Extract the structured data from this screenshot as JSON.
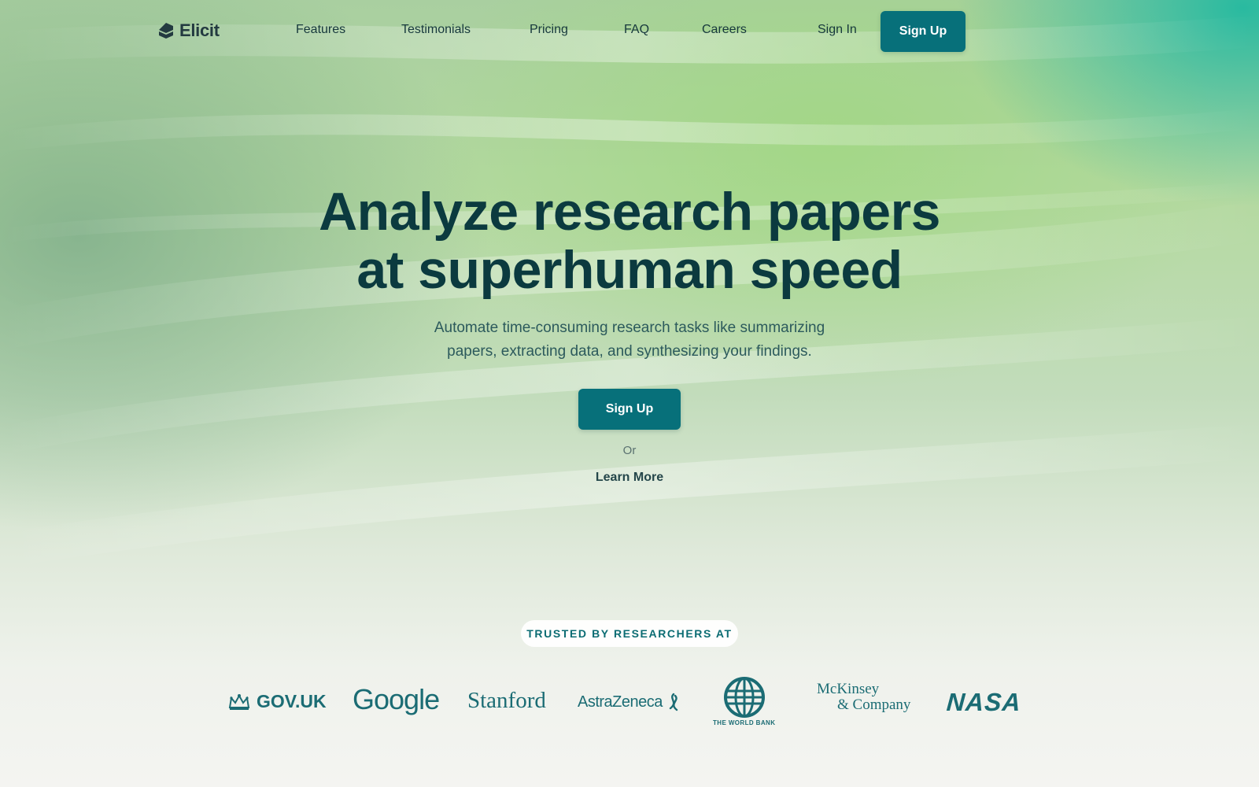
{
  "brand": {
    "name": "Elicit",
    "logo_icon": "elicit-logo-icon"
  },
  "nav": {
    "links": [
      {
        "label": "Features"
      },
      {
        "label": "Testimonials"
      },
      {
        "label": "Pricing"
      },
      {
        "label": "FAQ"
      },
      {
        "label": "Careers"
      }
    ],
    "sign_in": "Sign In",
    "sign_up": "Sign Up"
  },
  "hero": {
    "title_line1": "Analyze research papers",
    "title_line2": "at superhuman speed",
    "subtitle_line1": "Automate time-consuming research tasks like summarizing",
    "subtitle_line2": "papers, extracting data, and synthesizing your findings.",
    "cta": "Sign Up",
    "or": "Or",
    "learn_more": "Learn More"
  },
  "trusted": {
    "label": "TRUSTED BY RESEARCHERS AT",
    "logos": [
      {
        "name": "GOV.UK",
        "icon": "crown-icon"
      },
      {
        "name": "Google"
      },
      {
        "name": "Stanford"
      },
      {
        "name": "AstraZeneca",
        "icon": "astrazeneca-mark-icon"
      },
      {
        "name": "THE WORLD BANK",
        "icon": "globe-icon"
      },
      {
        "name_line1": "McKinsey",
        "name_line2": "& Company"
      },
      {
        "name": "NASA"
      }
    ]
  },
  "colors": {
    "primary": "#07707a",
    "heading": "#0b3a3f",
    "accent_teal": "#22b9a0",
    "logo_color": "#1b6c74"
  }
}
